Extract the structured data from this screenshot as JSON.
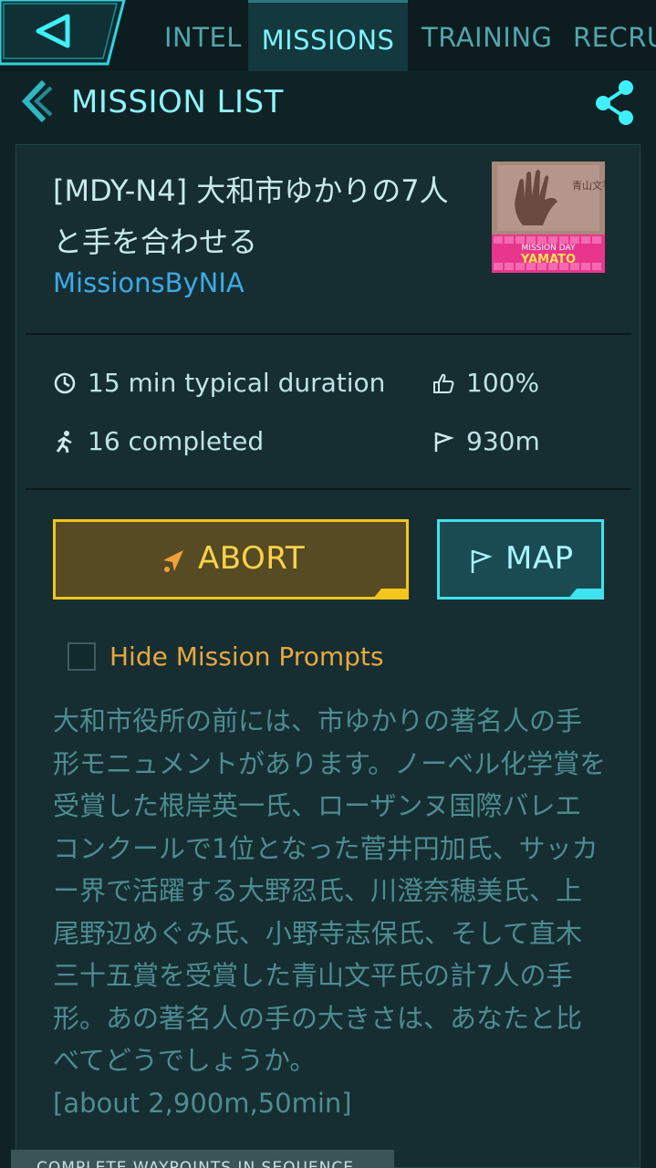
{
  "nav": {
    "tabs": [
      {
        "label": "INTEL",
        "active": false
      },
      {
        "label": "MISSIONS",
        "active": true
      },
      {
        "label": "TRAINING",
        "active": false
      },
      {
        "label": "RECRU",
        "active": false
      }
    ]
  },
  "header": {
    "title": "MISSION LIST"
  },
  "mission": {
    "title": "[MDY-N4] 大和市ゆかりの7人と手を合わせる",
    "author": "MissionsByNIA",
    "thumbnail_text": {
      "line1": "MISSION DAY",
      "line2": "YAMATO"
    },
    "stats": {
      "duration": "15 min typical duration",
      "completed": "16 completed",
      "rating": "100%",
      "distance": "930m"
    },
    "description": "大和市役所の前には、市ゆかりの著名人の手形モニュメントがあります。ノーベル化学賞を受賞した根岸英一氏、ローザンヌ国際バレエコンクールで1位となった菅井円加氏、サッカー界で活躍する大野忍氏、川澄奈穂美氏、上尾野辺めぐみ氏、小野寺志保氏、そして直木三十五賞を受賞した青山文平氏の計7人の手形。あの著名人の手の大きさは、あなたと比べてどうでしょうか。",
    "description_note": "[about 2,900m,50min]"
  },
  "buttons": {
    "abort": "ABORT",
    "map": "MAP"
  },
  "hide_prompts": {
    "label": "Hide Mission Prompts",
    "checked": false
  },
  "footer": {
    "label": "COMPLETE WAYPOINTS IN SEQUENCE"
  },
  "colors": {
    "background": "#0f2326",
    "accent_cyan": "#7ff2fa",
    "abort_yellow": "#f5c51d",
    "link_blue": "#3da9e6",
    "label_orange": "#e6a840"
  },
  "icons": [
    "back-arrow-icon",
    "share-icon",
    "clock-icon",
    "walker-icon",
    "thumbs-up-icon",
    "flag-icon",
    "abort-arrow-icon"
  ]
}
